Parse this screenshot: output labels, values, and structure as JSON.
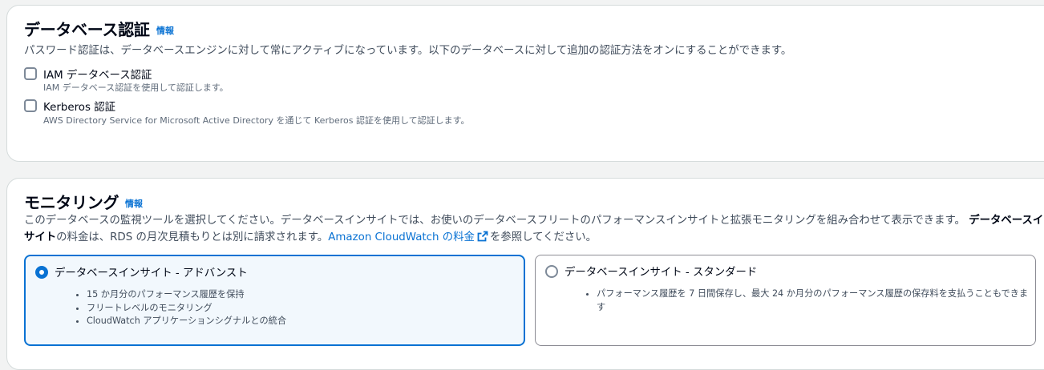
{
  "auth": {
    "title": "データベース認証",
    "info": "情報",
    "description": "パスワード認証は、データベースエンジンに対して常にアクティブになっています。以下のデータベースに対して追加の認証方法をオンにすることができます。",
    "options": [
      {
        "label": "IAM データベース認証",
        "description": "IAM データベース認証を使用して認証します。",
        "checked": false
      },
      {
        "label": "Kerberos 認証",
        "description": "AWS Directory Service for Microsoft Active Directory を通じて Kerberos 認証を使用して認証します。",
        "checked": false
      }
    ]
  },
  "monitoring": {
    "title": "モニタリング",
    "info": "情報",
    "description_part1": "このデータベースの監視ツールを選択してください。データベースインサイトでは、お使いのデータベースフリートのパフォーマンスインサイトと拡張モニタリングを組み合わせて表示できます。",
    "description_bold": "データベースインサイト",
    "description_part2": "の料金は、RDS の月次見積もりとは別に請求されます。",
    "link": "Amazon CloudWatch の料金",
    "description_part3": "を参照してください。",
    "tiles": [
      {
        "title": "データベースインサイト - アドバンスト",
        "selected": true,
        "bullets": [
          "15 か月分のパフォーマンス履歴を保持",
          "フリートレベルのモニタリング",
          "CloudWatch アプリケーションシグナルとの統合"
        ]
      },
      {
        "title": "データベースインサイト - スタンダード",
        "selected": false,
        "bullets": [
          "パフォーマンス履歴を 7 日間保存し、最大 24 か月分のパフォーマンス履歴の保存料を支払うこともできます"
        ]
      }
    ]
  },
  "colors": {
    "link": "#0972d3",
    "selected_border": "#0972d3",
    "selected_bg": "#f2f8fd"
  }
}
